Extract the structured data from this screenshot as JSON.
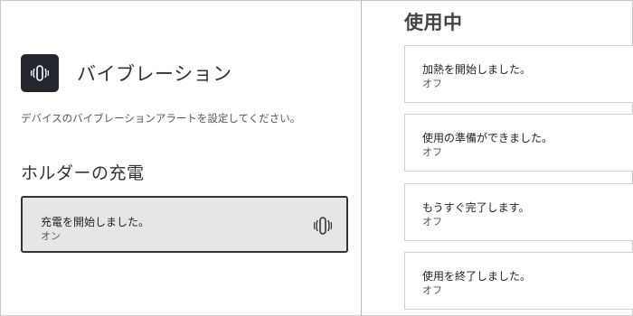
{
  "vibration": {
    "title": "バイブレーション",
    "description": "デバイスのバイブレーションアラートを設定してください。"
  },
  "holder_charging": {
    "section_title": "ホルダーの充電",
    "item": {
      "label": "充電を開始しました。",
      "value": "オン"
    }
  },
  "in_use": {
    "section_title": "使用中",
    "items": [
      {
        "label": "加熱を開始しました。",
        "value": "オフ"
      },
      {
        "label": "使用の準備ができました。",
        "value": "オフ"
      },
      {
        "label": "もうすぐ完了します。",
        "value": "オフ"
      },
      {
        "label": "使用を終了しました。",
        "value": "オフ"
      }
    ]
  },
  "colors": {
    "badge_bg": "#23262d",
    "selected_bg": "#e6e6e6",
    "selected_border": "#333333"
  },
  "icons": [
    "vibration-icon"
  ]
}
